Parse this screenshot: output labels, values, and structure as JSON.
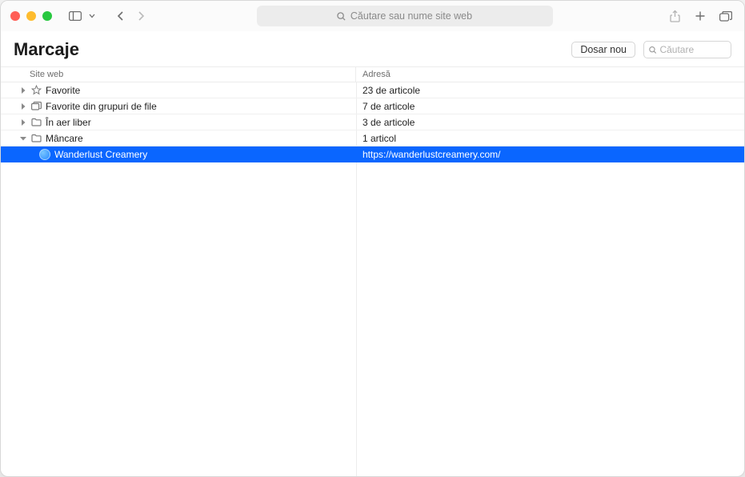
{
  "address_placeholder": "Căutare sau nume site web",
  "page_title": "Marcaje",
  "new_folder_label": "Dosar nou",
  "search_placeholder": "Căutare",
  "columns": {
    "site": "Site web",
    "address": "Adresă"
  },
  "rows": [
    {
      "name": "Favorite",
      "detail": "23 de articole",
      "icon": "star",
      "expanded": false,
      "hasChildren": true
    },
    {
      "name": "Favorite din grupuri de file",
      "detail": "7 de articole",
      "icon": "tabgroup",
      "expanded": false,
      "hasChildren": true
    },
    {
      "name": "În aer liber",
      "detail": "3 de articole",
      "icon": "folder",
      "expanded": false,
      "hasChildren": true
    },
    {
      "name": "Mâncare",
      "detail": "1 articol",
      "icon": "folder",
      "expanded": true,
      "hasChildren": true
    }
  ],
  "selected_child": {
    "name": "Wanderlust Creamery",
    "url": "https://wanderlustcreamery.com/"
  }
}
